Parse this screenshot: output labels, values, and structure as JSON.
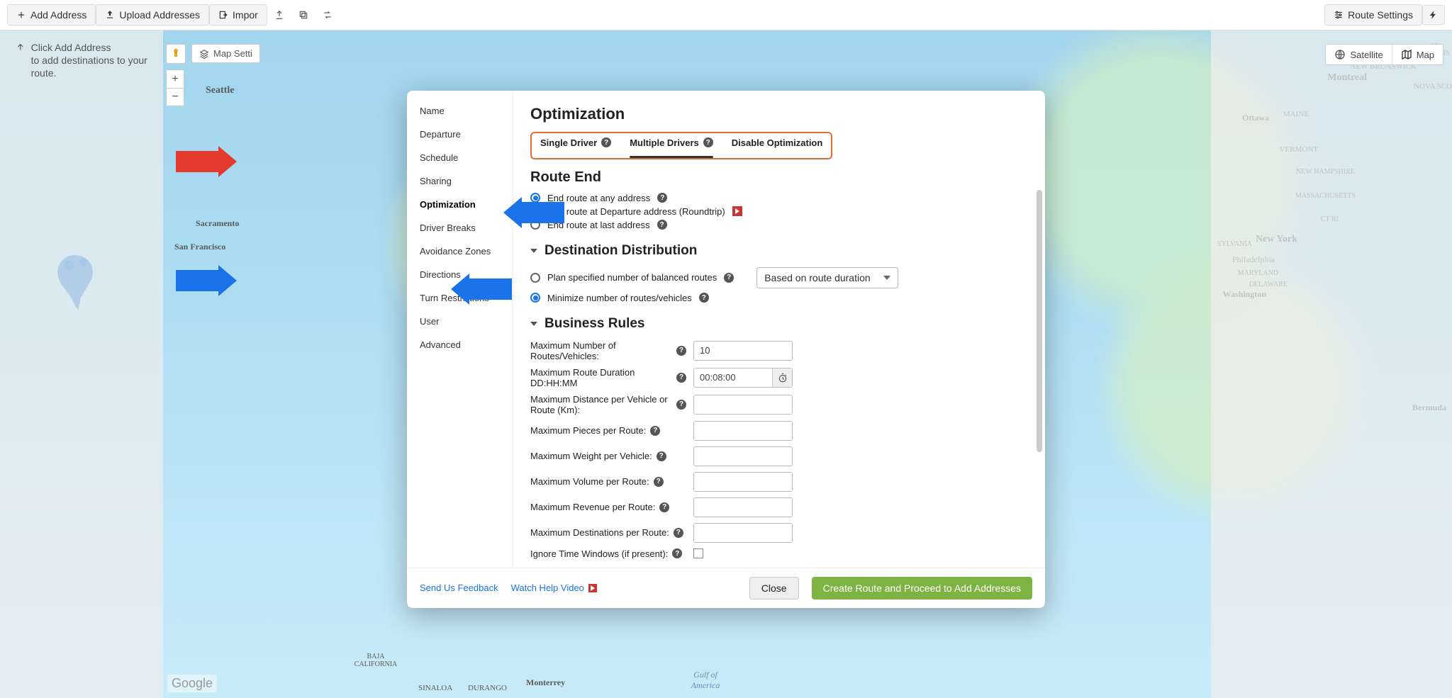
{
  "toolbar": {
    "addAddress": "Add Address",
    "uploadAddresses": "Upload Addresses",
    "importPartial": "Impor",
    "routeSettings": "Route Settings"
  },
  "hint": {
    "line1": "Click Add Address",
    "line2": "to add destinations to your route."
  },
  "mapControls": {
    "mapSettingsPartial": "Map Setti",
    "satellite": "Satellite",
    "map": "Map",
    "google": "Google",
    "zoomIn": "+",
    "zoomOut": "−"
  },
  "mapLabels": {
    "seattle": "Seattle",
    "sacramento": "Sacramento",
    "sanfrancisco": "San Francisco",
    "montreal": "Montreal",
    "ottawa": "Ottawa",
    "newyork": "New York",
    "philadelphia": "Philadelphia",
    "washington": "Washington",
    "maine": "MAINE",
    "vermont": "VERMONT",
    "newhampshire": "NEW HAMPSHIRE",
    "massachusetts": "MASSACHUSETTS",
    "ctri": "CT RI",
    "maryland": "MARYLAND",
    "delaware": "DELAWARE",
    "sylvania": "SYLVANIA",
    "newbrunswick": "NEW BRUNSWICK",
    "novascotia": "NOVA SCO",
    "prewis": "PR EW IS",
    "bermuda": "Bermuda",
    "monterrey": "Monterrey",
    "sinaloa": "SINALOA",
    "durango": "DURANGO",
    "bajacalifornia": "BAJA CALIFORNIA",
    "gulfamerica": "Gulf of America"
  },
  "modal": {
    "nav": {
      "name": "Name",
      "departure": "Departure",
      "schedule": "Schedule",
      "sharing": "Sharing",
      "optimization": "Optimization",
      "driverBreaks": "Driver Breaks",
      "avoidanceZones": "Avoidance Zones",
      "directions": "Directions",
      "turnRestrictions": "Turn Restrictions",
      "user": "User",
      "advanced": "Advanced"
    },
    "main": {
      "optimizationTitle": "Optimization",
      "tabs": {
        "single": "Single Driver",
        "multiple": "Multiple Drivers",
        "disable": "Disable Optimization"
      },
      "routeEndTitle": "Route End",
      "routeEnd": {
        "any": "End route at any address",
        "roundtrip": "End route at Departure address (Roundtrip)",
        "last": "End route at last address"
      },
      "destDistTitle": "Destination Distribution",
      "destDist": {
        "plan": "Plan specified number of balanced routes",
        "basis": "Based on route duration",
        "minimize": "Minimize number of routes/vehicles"
      },
      "businessRulesTitle": "Business Rules",
      "rules": {
        "maxRoutesLabel": "Maximum Number of Routes/Vehicles:",
        "maxRoutesValue": "10",
        "maxDurationLabel": "Maximum Route Duration DD:HH:MM",
        "maxDurationValue": "00:08:00",
        "maxDistanceLabel": "Maximum Distance per Vehicle or Route (Km):",
        "maxPiecesLabel": "Maximum Pieces per Route:",
        "maxWeightLabel": "Maximum Weight per Vehicle:",
        "maxVolumeLabel": "Maximum Volume per Route:",
        "maxRevenueLabel": "Maximum Revenue per Route:",
        "maxDestLabel": "Maximum Destinations per Route:",
        "ignoreTWLabel": "Ignore Time Windows (if present):"
      }
    },
    "footer": {
      "feedback": "Send Us Feedback",
      "helpVideo": "Watch Help Video",
      "close": "Close",
      "primary": "Create Route and Proceed to Add Addresses"
    }
  }
}
